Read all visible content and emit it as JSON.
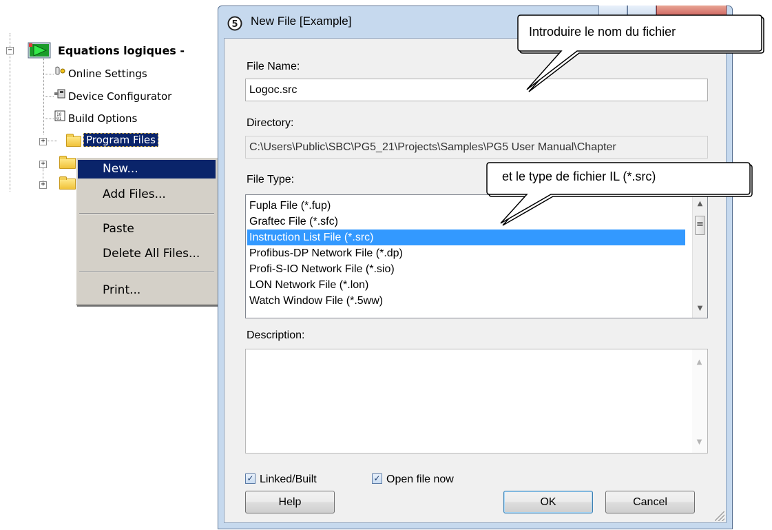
{
  "tree": {
    "root_label": "Equations logiques -",
    "items": [
      {
        "label": "Online Settings",
        "icon": "online-settings-icon"
      },
      {
        "label": "Device Configurator",
        "icon": "device-configurator-icon"
      },
      {
        "label": "Build Options",
        "icon": "build-options-icon"
      },
      {
        "label": "Program Files",
        "icon": "folder-icon",
        "selected": true
      }
    ]
  },
  "context_menu": {
    "items": [
      "New...",
      "Add Files...",
      "Paste",
      "Delete All Files...",
      "Print..."
    ],
    "highlighted": "New..."
  },
  "dialog": {
    "title": "New File [Example]",
    "file_name_label": "File Name:",
    "file_name_value": "Logoc.src",
    "directory_label": "Directory:",
    "directory_value": "C:\\Users\\Public\\SBC\\PG5_21\\Projects\\Samples\\PG5 User Manual\\Chapter",
    "file_type_label": "File Type:",
    "file_types": [
      "Fupla File (*.fup)",
      "Graftec File (*.sfc)",
      "Instruction List File (*.src)",
      "Profibus-DP Network File (*.dp)",
      "Profi-S-IO Network File (*.sio)",
      "LON Network File (*.lon)",
      "Watch Window File (*.5ww)"
    ],
    "selected_file_type": "Instruction List File (*.src)",
    "description_label": "Description:",
    "description_value": "",
    "linked_built_label": "Linked/Built",
    "linked_built_checked": true,
    "open_file_now_label": "Open file now",
    "open_file_now_checked": true,
    "help_label": "Help",
    "ok_label": "OK",
    "cancel_label": "Cancel"
  },
  "callouts": {
    "file_name_hint": "Introduire le nom du fichier",
    "file_type_hint": "et le type de fichier IL (*.src)"
  },
  "colors": {
    "menu_highlight": "#0a246a",
    "list_selection": "#3399ff",
    "dialog_frame": "#c6d9ee"
  }
}
